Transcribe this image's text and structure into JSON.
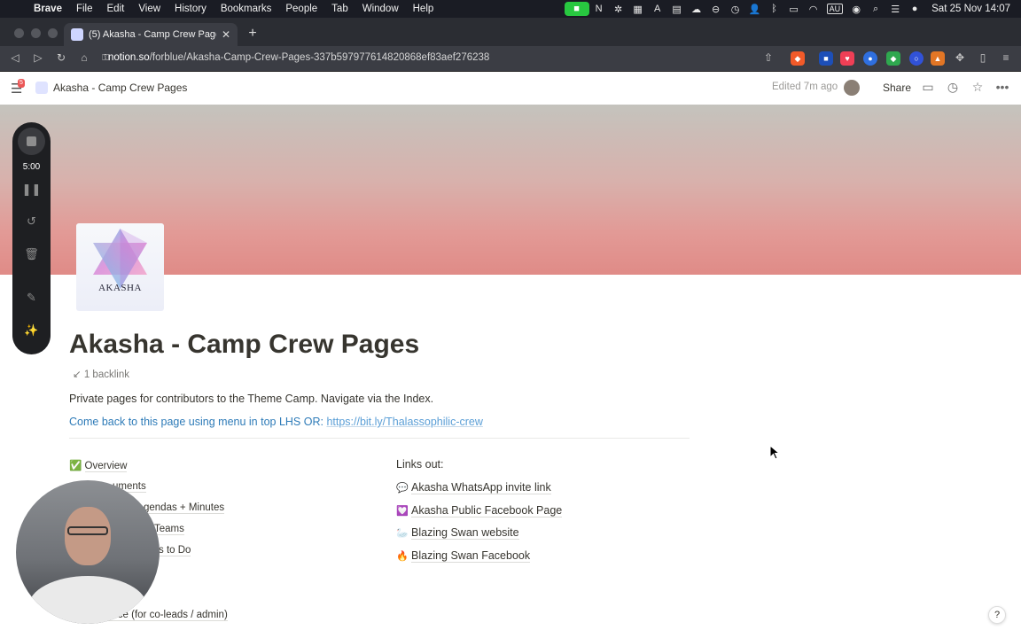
{
  "menubar": {
    "apple": "",
    "items": [
      "Brave",
      "File",
      "Edit",
      "View",
      "History",
      "Bookmarks",
      "People",
      "Tab",
      "Window",
      "Help"
    ],
    "keyboard": "AU",
    "clock": "Sat 25 Nov  14:07"
  },
  "browser": {
    "tab_title": "(5) Akasha - Camp Crew Pages",
    "url_domain": "notion.so",
    "url_path": "/forblue/Akasha-Camp-Crew-Pages-337b597977614820868ef83aef276238"
  },
  "notion_top": {
    "notification_count": "5",
    "breadcrumb": "Akasha - Camp Crew Pages",
    "edited": "Edited 7m ago",
    "share": "Share"
  },
  "recorder": {
    "time": "5:00"
  },
  "page": {
    "icon_label": "AKASHA",
    "title": "Akasha - Camp Crew Pages",
    "backlinks": "1 backlink",
    "description": "Private pages for contributors to the Theme Camp. Navigate via the Index.",
    "comeback_text": "Come back to this page using menu in top LHS OR: ",
    "comeback_link": "https://bit.ly/Thalassophilic-crew",
    "left_list": [
      {
        "icon": "✅",
        "label": "Overview"
      },
      {
        "icon": "",
        "label": "uments"
      },
      {
        "icon": "",
        "label": "gendas + Minutes"
      },
      {
        "icon": "",
        "label": "Teams"
      },
      {
        "icon": "",
        "label": "s to Do"
      },
      {
        "icon": "",
        "label": "ence (for co-leads / admin)"
      }
    ],
    "links_out_heading": "Links out:",
    "links_out": [
      {
        "icon": "💬",
        "label": "Akasha WhatsApp invite link"
      },
      {
        "icon": "💟",
        "label": "Akasha Public Facebook Page"
      },
      {
        "icon": "🦢",
        "label": "Blazing Swan website"
      },
      {
        "icon": "🔥",
        "label": "Blazing Swan Facebook"
      }
    ]
  },
  "help": "?"
}
